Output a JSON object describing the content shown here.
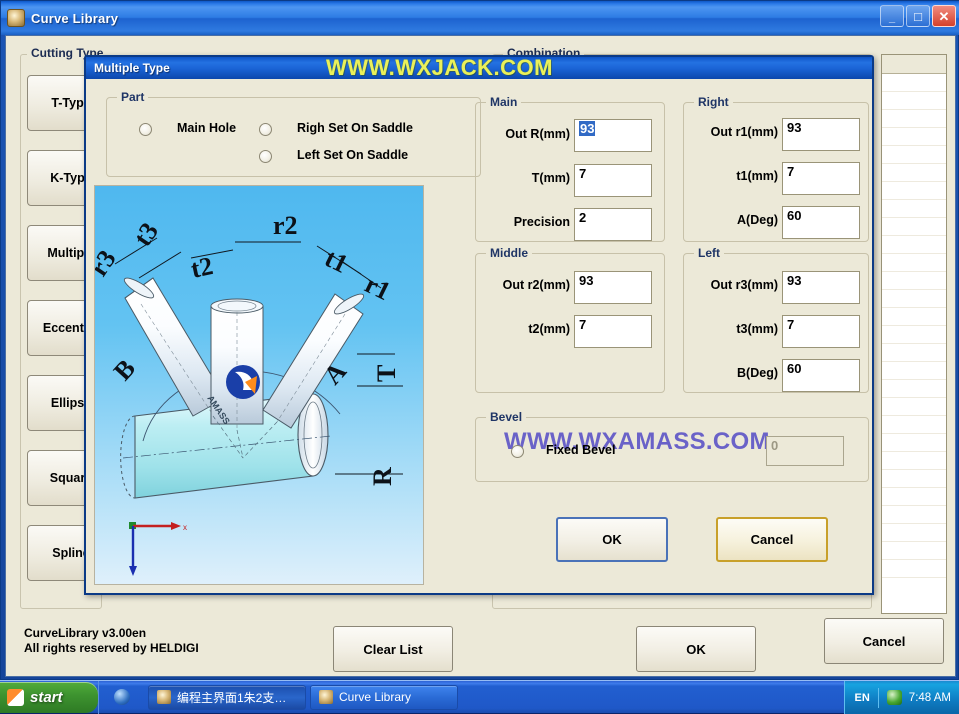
{
  "main_window": {
    "title": "Curve Library",
    "icon": "app-icon",
    "window_controls": {
      "minimize": "_",
      "maximize": "□",
      "close": "✕"
    },
    "groups": {
      "cutting_type": "Cutting Type",
      "combination": "Combination"
    },
    "cutting_type_buttons": [
      {
        "label": "T-Type"
      },
      {
        "label": "K-Type"
      },
      {
        "label": "Multiple"
      },
      {
        "label": "Eccentric"
      },
      {
        "label": "Ellipse"
      },
      {
        "label": "Square"
      },
      {
        "label": "Spline"
      }
    ],
    "version_line1": "CurveLibrary v3.00en",
    "version_line2": "All rights reserved by HELDIGI",
    "buttons": {
      "clear_list": "Clear List",
      "ok": "OK",
      "cancel": "Cancel"
    }
  },
  "dialog": {
    "title": "Multiple Type",
    "watermark_title": "WWW.WXJACK.COM",
    "watermark_body": "WWW.WXAMASS.COM",
    "watermark_title_color": "#eaf05a",
    "watermark_body_color": "#6a62c8",
    "part": {
      "legend": "Part",
      "options": [
        {
          "label": "Main Hole",
          "selected": false
        },
        {
          "label": "Righ Set On Saddle",
          "selected": false
        },
        {
          "label": "Left Set On Saddle",
          "selected": false
        }
      ]
    },
    "main": {
      "legend": "Main",
      "fields": [
        {
          "label": "Out R(mm)",
          "value": "93",
          "selected": true
        },
        {
          "label": "T(mm)",
          "value": "7",
          "selected": false
        },
        {
          "label": "Precision",
          "value": "2",
          "selected": false
        }
      ]
    },
    "right": {
      "legend": "Right",
      "fields": [
        {
          "label": "Out r1(mm)",
          "value": "93"
        },
        {
          "label": "t1(mm)",
          "value": "7"
        },
        {
          "label": "A(Deg)",
          "value": "60"
        }
      ]
    },
    "middle": {
      "legend": "Middle",
      "fields": [
        {
          "label": "Out r2(mm)",
          "value": "93"
        },
        {
          "label": "t2(mm)",
          "value": "7"
        }
      ]
    },
    "left": {
      "legend": "Left",
      "fields": [
        {
          "label": "Out r3(mm)",
          "value": "93"
        },
        {
          "label": "t3(mm)",
          "value": "7"
        },
        {
          "label": "B(Deg)",
          "value": "60"
        }
      ]
    },
    "bevel": {
      "legend": "Bevel",
      "option_label": "Fixed Bevel",
      "option_selected": false,
      "value": "0",
      "disabled": true
    },
    "buttons": {
      "ok": "OK",
      "cancel": "Cancel"
    },
    "diagram": {
      "labels": [
        "r3",
        "t3",
        "t2",
        "r2",
        "t1",
        "r1",
        "B",
        "A",
        "T",
        "R"
      ],
      "brand": "AMASS"
    }
  },
  "taskbar": {
    "start_label": "start",
    "tasks": [
      {
        "label": "编程主界面1朱2支…",
        "active": true
      },
      {
        "label": "Curve Library",
        "active": false
      }
    ],
    "tray": {
      "language": "EN",
      "clock": "7:48 AM"
    }
  }
}
